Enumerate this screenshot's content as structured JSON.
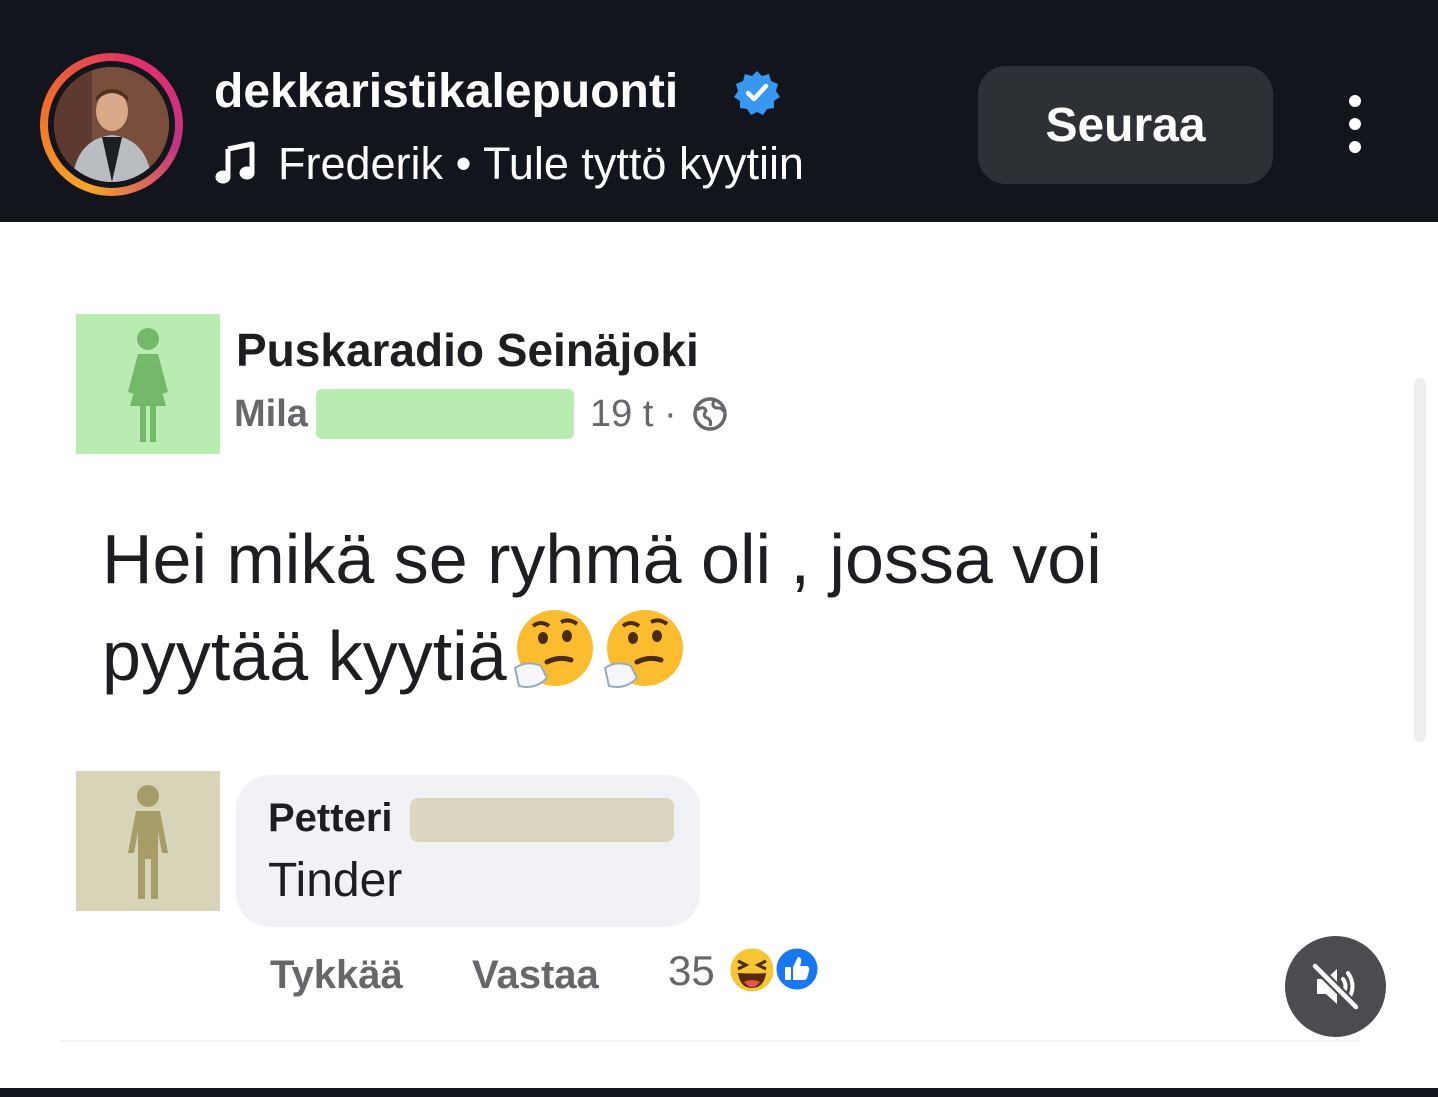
{
  "header": {
    "username": "dekkaristikalepuonti",
    "verified_icon": "verified-badge-icon",
    "song_artist": "Frederik",
    "song_separator": "•",
    "song_title": "Tule tyttö kyytiin",
    "follow_label": "Seuraa",
    "more_icon": "more-vertical-icon"
  },
  "post": {
    "group_name": "Puskaradio Seinäjoki",
    "author_first_name": "Mila",
    "time": "19 t ·",
    "privacy_icon": "globe-icon",
    "text": "Hei mikä se ryhmä oli , jossa voi pyytää kyytiä",
    "emojis": [
      "thinking-face-emoji",
      "thinking-face-emoji"
    ]
  },
  "comment": {
    "author_first_name": "Petteri",
    "text": "Tinder",
    "like_label": "Tykkää",
    "reply_label": "Vastaa",
    "reaction_count": "35",
    "reactions": [
      "haha-reaction-icon",
      "like-reaction-icon"
    ]
  },
  "controls": {
    "mute_icon": "speaker-muted-icon"
  },
  "colors": {
    "top_bar": "#12151c",
    "follow_button": "#2d3035",
    "verified_blue": "#3897f0",
    "female_avatar_bg": "#b9ecb0",
    "male_avatar_bg": "#d8d4b8",
    "comment_bubble": "#f0f2f5"
  }
}
